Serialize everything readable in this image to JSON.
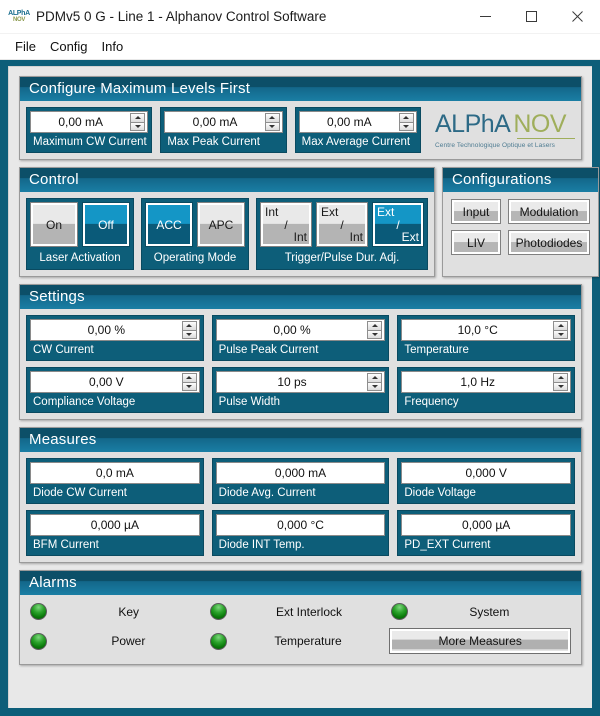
{
  "window": {
    "title": "PDMv5 0 G - Line 1 - Alphanov Control Software",
    "icon_line1": "ALPhA",
    "icon_line2": "NOV",
    "minimize_label": "minimize",
    "maximize_label": "maximize",
    "close_label": "close"
  },
  "menu": {
    "items": [
      {
        "label": "File"
      },
      {
        "label": "Config"
      },
      {
        "label": "Info"
      }
    ]
  },
  "configure": {
    "title": "Configure Maximum Levels First",
    "fields": [
      {
        "value": "0,00 mA",
        "label": "Maximum CW Current"
      },
      {
        "value": "0,00 mA",
        "label": "Max Peak Current"
      },
      {
        "value": "0,00 mA",
        "label": "Max Average Current"
      }
    ],
    "logo": {
      "alpha": "ALPhA",
      "nov": "NOV",
      "subtitle": "Centre Technologique Optique et Lasers",
      "alpha_color": "#2d6a86",
      "nov_color": "#9fae5b"
    }
  },
  "control": {
    "title": "Control",
    "groups": [
      {
        "caption": "Laser Activation",
        "buttons": [
          {
            "label": "On",
            "selected": false
          },
          {
            "label": "Off",
            "selected": true
          }
        ]
      },
      {
        "caption": "Operating Mode",
        "buttons": [
          {
            "label": "ACC",
            "selected": true
          },
          {
            "label": "APC",
            "selected": false
          }
        ]
      }
    ],
    "trigger": {
      "caption": "Trigger/Pulse Dur. Adj.",
      "buttons": [
        {
          "top": "Int",
          "sep": "/",
          "bottom": "Int",
          "selected": false
        },
        {
          "top": "Ext",
          "sep": "/",
          "bottom": "Int",
          "selected": false
        },
        {
          "top": "Ext",
          "sep": "/",
          "bottom": "Ext",
          "selected": true
        }
      ]
    }
  },
  "configurations": {
    "title": "Configurations",
    "buttons": [
      {
        "label": "Input"
      },
      {
        "label": "Modulation"
      },
      {
        "label": "LIV"
      },
      {
        "label": "Photodiodes"
      }
    ]
  },
  "settings": {
    "title": "Settings",
    "fields": [
      {
        "value": "0,00 %",
        "label": "CW Current"
      },
      {
        "value": "0,00 %",
        "label": "Pulse Peak Current"
      },
      {
        "value": "10,0 °C",
        "label": "Temperature"
      },
      {
        "value": "0,00 V",
        "label": "Compliance Voltage"
      },
      {
        "value": "10 ps",
        "label": "Pulse Width"
      },
      {
        "value": "1,0 Hz",
        "label": "Frequency"
      }
    ]
  },
  "measures": {
    "title": "Measures",
    "fields": [
      {
        "value": "0,0 mA",
        "label": "Diode CW Current"
      },
      {
        "value": "0,000 mA",
        "label": "Diode Avg. Current"
      },
      {
        "value": "0,000 V",
        "label": "Diode Voltage"
      },
      {
        "value": "0,000 µA",
        "label": "BFM Current"
      },
      {
        "value": "0,000 °C",
        "label": "Diode INT Temp."
      },
      {
        "value": "0,000 µA",
        "label": "PD_EXT Current"
      }
    ]
  },
  "alarms": {
    "title": "Alarms",
    "led_color": "#1f9b1f",
    "indicators": [
      {
        "label": "Key",
        "state": "ok"
      },
      {
        "label": "Ext Interlock",
        "state": "ok"
      },
      {
        "label": "System",
        "state": "ok"
      },
      {
        "label": "Power",
        "state": "ok"
      },
      {
        "label": "Temperature",
        "state": "ok"
      }
    ],
    "more_measures_label": "More Measures"
  },
  "theme": {
    "teal_dark": "#0d5e79",
    "teal_header": "#0c4f68",
    "accent_blue": "#1496c6",
    "panel_gray": "#e0e0e0"
  }
}
